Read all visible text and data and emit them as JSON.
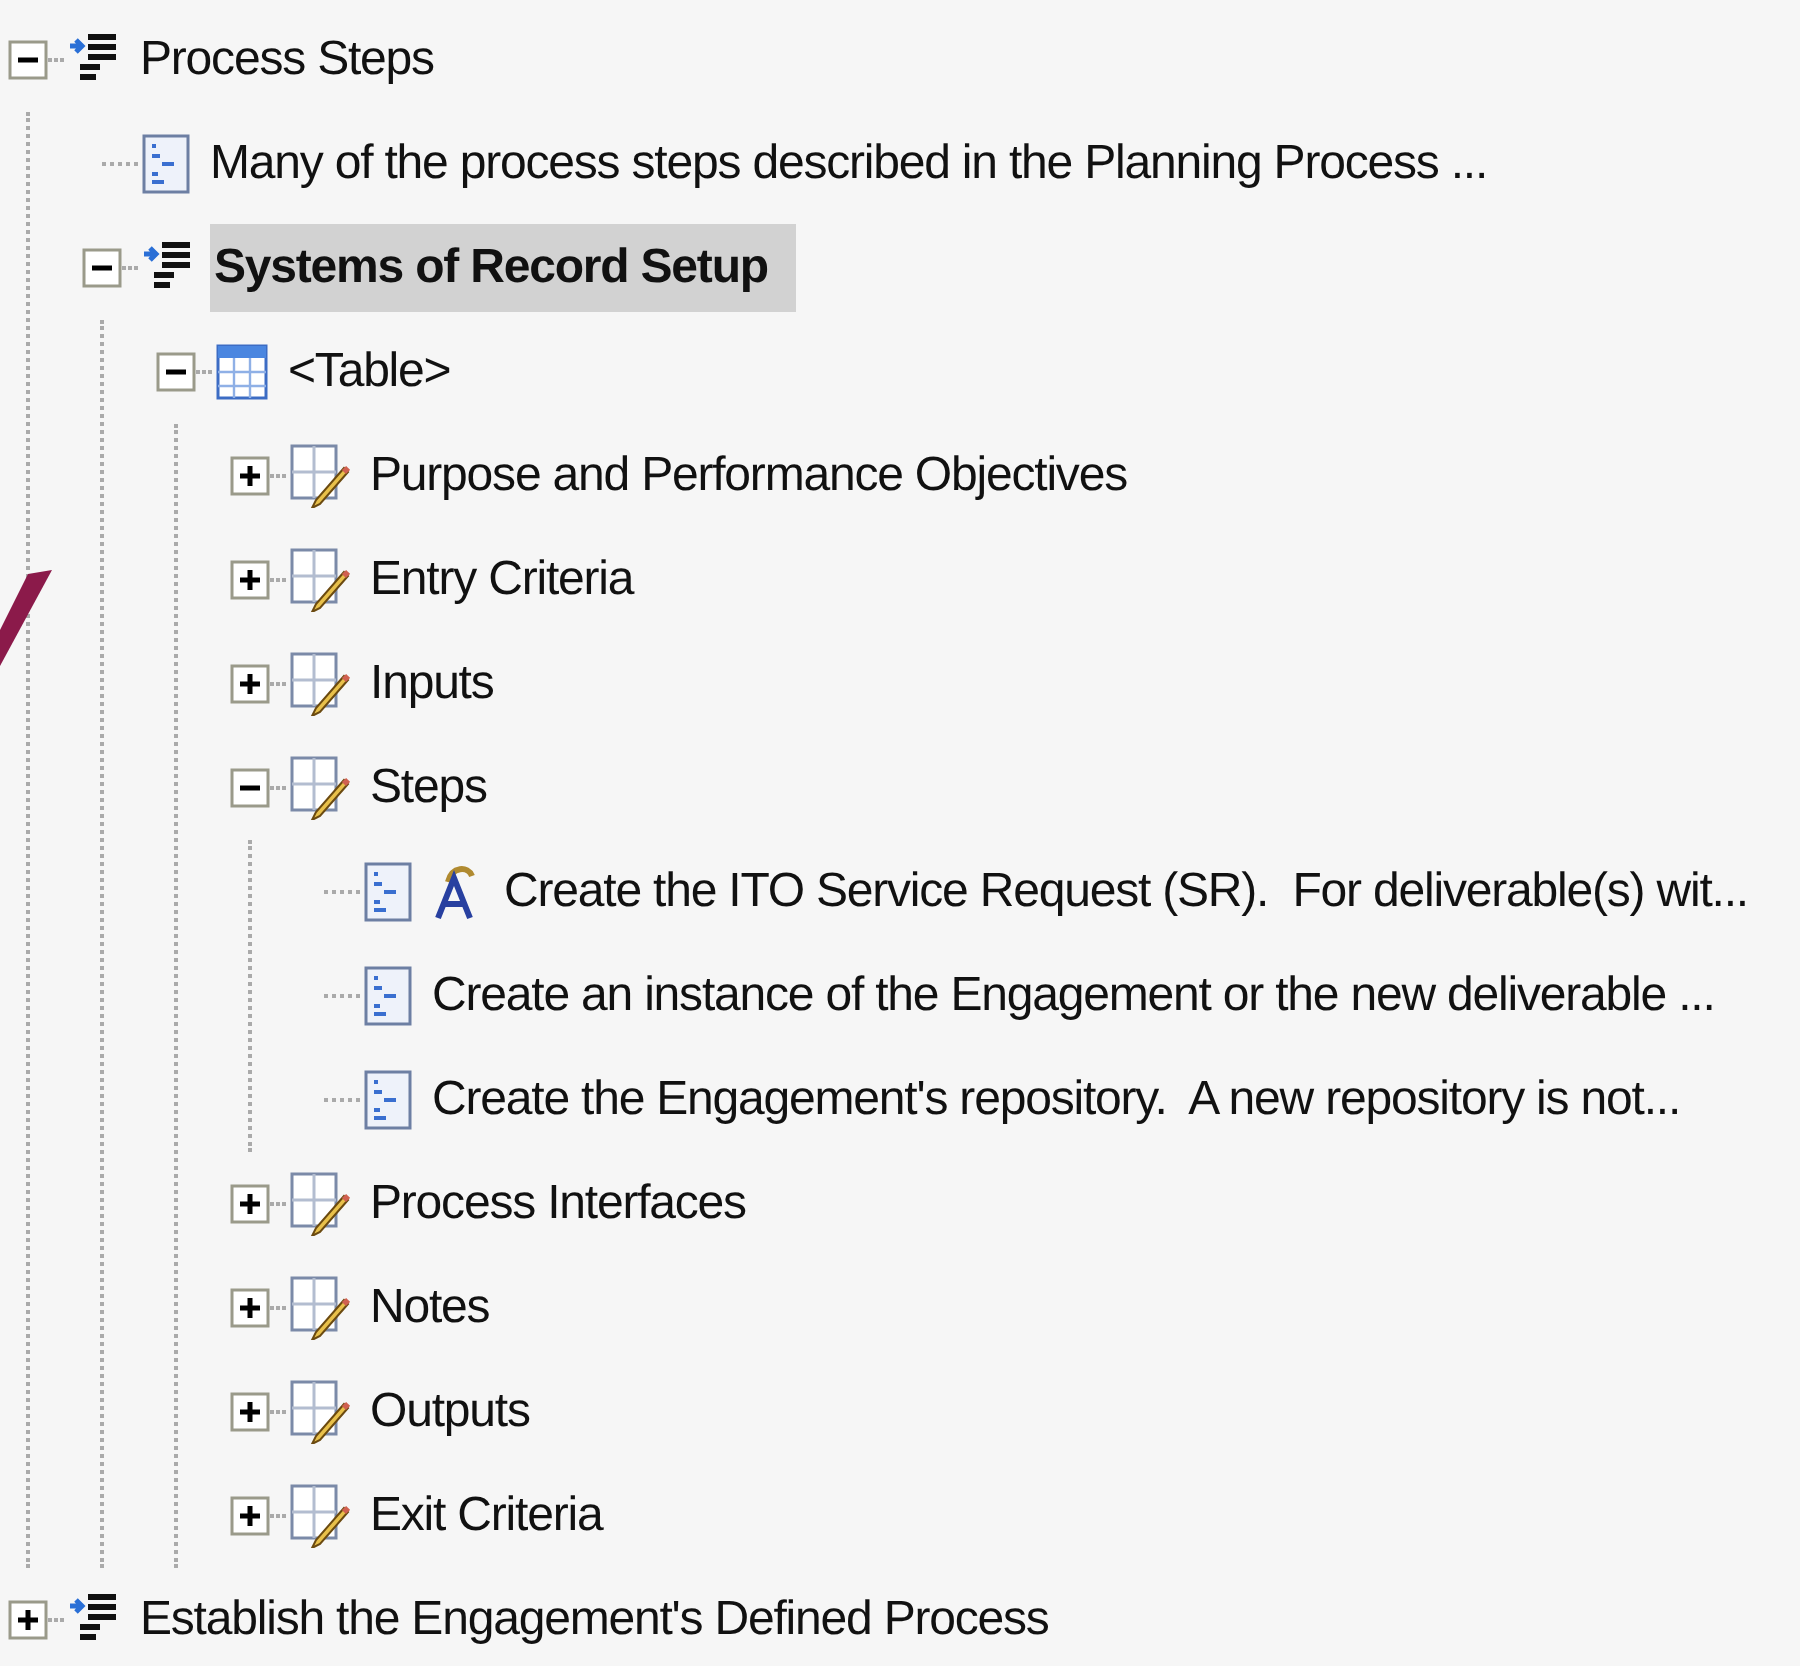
{
  "tree": [
    {
      "label": "Process Steps",
      "kind": "section",
      "expanded": true,
      "selected": false,
      "children": [
        {
          "label": "Many of the process steps described in the Planning Process ...",
          "kind": "description",
          "selected": false
        },
        {
          "label": "Systems of Record Setup",
          "kind": "section",
          "expanded": true,
          "selected": true,
          "children": [
            {
              "label": "<Table>",
              "kind": "table",
              "expanded": true,
              "selected": false,
              "children": [
                {
                  "label": "Purpose and Performance Objectives",
                  "kind": "field",
                  "expanded": false,
                  "selected": false
                },
                {
                  "label": "Entry Criteria",
                  "kind": "field",
                  "expanded": false,
                  "selected": false
                },
                {
                  "label": "Inputs",
                  "kind": "field",
                  "expanded": false,
                  "selected": false
                },
                {
                  "label": "Steps",
                  "kind": "field",
                  "expanded": true,
                  "selected": false,
                  "children": [
                    {
                      "label": "Create the ITO Service Request (SR).  For deliverable(s) wit...",
                      "kind": "description",
                      "annotated": true,
                      "selected": false
                    },
                    {
                      "label": "Create an instance of the Engagement or the new deliverable ...",
                      "kind": "description",
                      "annotated": false,
                      "selected": false
                    },
                    {
                      "label": "Create the Engagement's repository.  A new repository is not...",
                      "kind": "description",
                      "annotated": false,
                      "selected": false
                    }
                  ]
                },
                {
                  "label": "Process Interfaces",
                  "kind": "field",
                  "expanded": false,
                  "selected": false
                },
                {
                  "label": "Notes",
                  "kind": "field",
                  "expanded": false,
                  "selected": false
                },
                {
                  "label": "Outputs",
                  "kind": "field",
                  "expanded": false,
                  "selected": false
                },
                {
                  "label": "Exit Criteria",
                  "kind": "field",
                  "expanded": false,
                  "selected": false
                }
              ]
            }
          ]
        }
      ]
    },
    {
      "label": "Establish the Engagement's Defined Process",
      "kind": "section",
      "expanded": false,
      "selected": false
    }
  ]
}
